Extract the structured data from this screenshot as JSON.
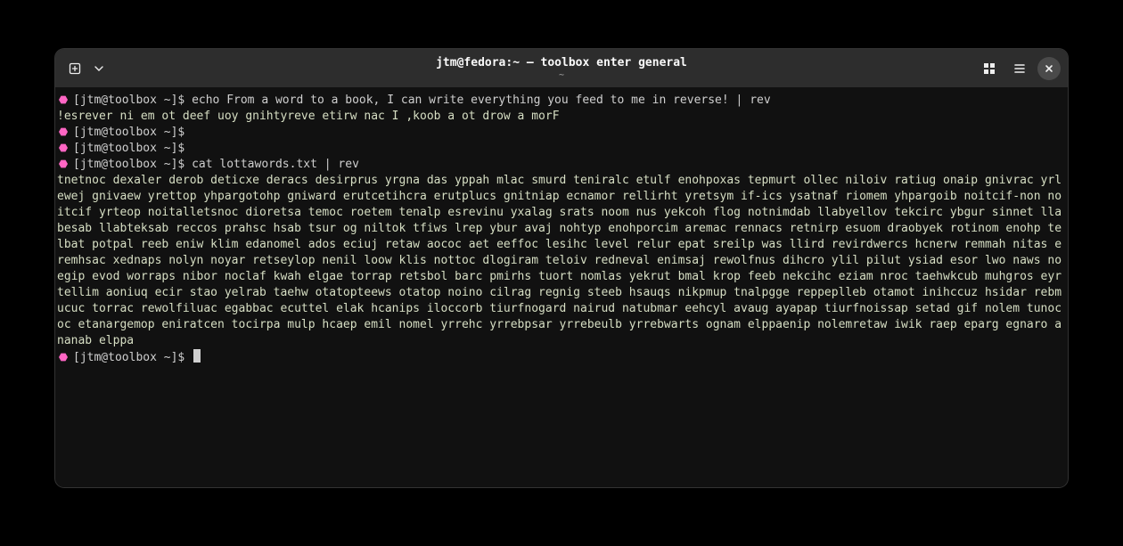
{
  "window": {
    "title": "jtm@fedora:~ — toolbox enter general",
    "subtitle": "~"
  },
  "colors": {
    "bg": "#000000",
    "termbg": "#111111",
    "titlebar": "#2d2d2d",
    "fg": "#d7dfc4",
    "prompt_icon": "#ff66c4",
    "prompt_fg": "#cfcfcf"
  },
  "terminal": {
    "prompt": "[jtm@toolbox ~]$",
    "lines": {
      "l1_cmd": "echo From a word to a book, I can write everything you feed to me in reverse! | rev",
      "l2_out": "!esrever ni em ot deef uoy gnihtyreve etirw nac I ,koob a ot drow a morF",
      "l3_cmd": "",
      "l4_cmd": "",
      "l5_cmd": "cat lottawords.txt | rev",
      "l6_out": "tnetnoc dexaler derob deticxe deracs desirprus yrgna das yppah mlac smurd teniralc etulf enohpoxas tepmurt ollec niloiv ratiug onaip gnivrac yrlewej gnivaew yrettop yhpargotohp gniward erutcetihcra erutplucs gnitniap ecnamor rellirht yretsym if-ics ysatnaf riomem yhpargoib noitcif-non noitcif yrteop noitalletsnoc dioretsa temoc roetem tenalp esrevinu yxalag srats noom nus yekcoh flog notnimdab llabyellov tekcirc ybgur sinnet llabesab llabteksab reccos prahsc hsab tsur og niltok tfiws lrep ybur avaj nohtyp enohporcim aremac rennacs retnirp esuom draobyek rotinom enohp telbat potpal reeb eniw klim edanomel ados eciuj retaw aococ aet eeffoc lesihc level relur epat sreilp was llird revirdwercs hcnerw remmah nitas eremhsac xednaps nolyn noyar retseylop nenil loow klis nottoc dlogiram teloiv redneval enimsaj rewolfnus dihcro ylil pilut ysiad esor lwo naws noegip evod worraps nibor noclaf kwah elgae torrap retsbol barc pmirhs tuort nomlas yekrut bmal krop feeb nekcihc eziam nroc taehwkcub muhgros eyr tellim aoniuq ecir stao yelrab taehw otatopteews otatop noino cilrag regnig steeb hsauqs nikpmup tnalpgge reppeplleb otamot inihccuz hsidar rebmucuc torrac rewolfiluac egabbac ecuttel elak hcanips iloccorb tiurfnogard nairud natubmar eehcyl avaug ayapap tiurfnoissap setad gif nolem tunococ etanargemop eniratcen tocirpa mulp hcaep emil nomel yrrehc yrrebpsar yrrebeulb yrrebwarts ognam elppaenip nolemretaw iwik raep eparg egnaro ananab elppa",
      "l7_cursor": ""
    }
  }
}
